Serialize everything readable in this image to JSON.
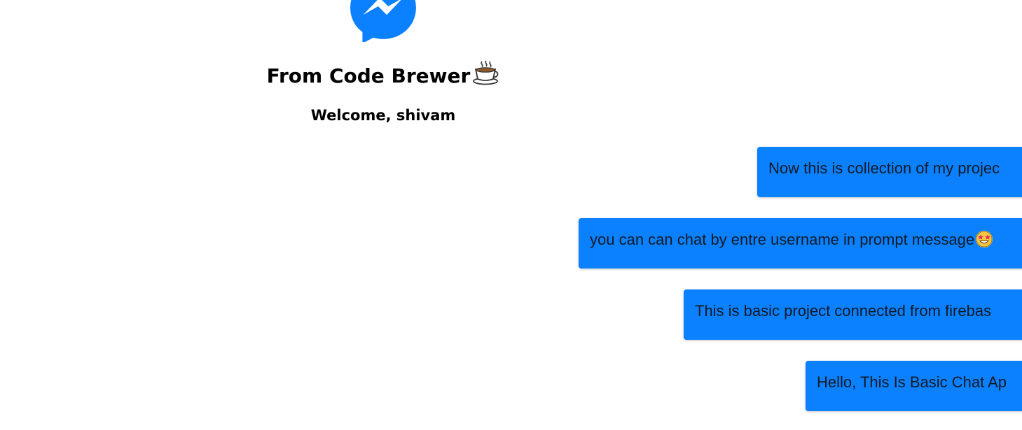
{
  "colors": {
    "accent": "#0b81ff",
    "message_text": "#111a24",
    "background": "#ffffff"
  },
  "header": {
    "logo_icon": "messenger-logo-icon",
    "title": "From Code Brewer",
    "title_emoji_icon": "hot-beverage-icon",
    "welcome": "Welcome, shivam"
  },
  "messages": [
    {
      "text": "Now this is collection of my projec"
    },
    {
      "text": "you can can chat by entre username in prompt message",
      "emoji_icon": "star-struck-emoji-icon"
    },
    {
      "text": "This is basic project connected from firebas"
    },
    {
      "text": "Hello, This Is Basic Chat Ap"
    }
  ]
}
